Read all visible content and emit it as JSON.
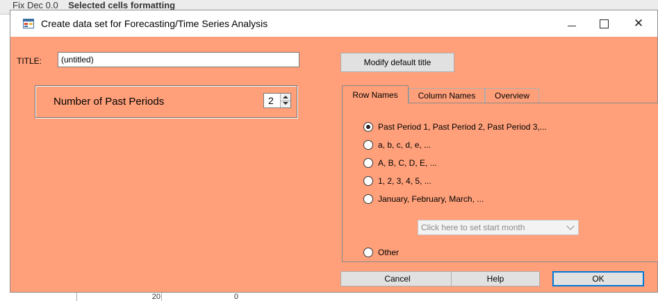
{
  "background": {
    "toolbar_text": "Fix Dec  0.0",
    "toolbar_bold": "Selected cells formatting",
    "cell_values": [
      "20",
      "0"
    ]
  },
  "window": {
    "title": "Create data set for Forecasting/Time Series Analysis",
    "minimize_glyph": "—",
    "close_glyph": "✕"
  },
  "form": {
    "title_label": "TITLE:",
    "title_value": "(untitled)",
    "modify_title_button": "Modify default title",
    "periods_label": "Number of Past Periods",
    "periods_value": "2"
  },
  "tabs": [
    {
      "label": "Row Names",
      "active": true
    },
    {
      "label": "Column Names",
      "active": false
    },
    {
      "label": "Overview",
      "active": false
    }
  ],
  "row_name_options": [
    {
      "label": "Past Period 1, Past Period 2, Past Period 3,...",
      "checked": true
    },
    {
      "label": "a, b, c, d, e, ...",
      "checked": false
    },
    {
      "label": "A, B, C, D, E, ...",
      "checked": false
    },
    {
      "label": "1, 2, 3, 4, 5, ...",
      "checked": false
    },
    {
      "label": "January, February, March, ...",
      "checked": false
    },
    {
      "label": "Other",
      "checked": false
    }
  ],
  "start_month_combo": {
    "placeholder": "Click here to set start month"
  },
  "buttons": {
    "cancel": "Cancel",
    "help": "Help",
    "ok": "OK"
  },
  "colors": {
    "dialog_background": "#ffa07a",
    "ok_border": "#0078d7"
  },
  "icons": [
    "app-icon",
    "minimize-icon",
    "maximize-icon",
    "close-icon",
    "spin-up-icon",
    "spin-down-icon",
    "dropdown-chevron-icon"
  ]
}
